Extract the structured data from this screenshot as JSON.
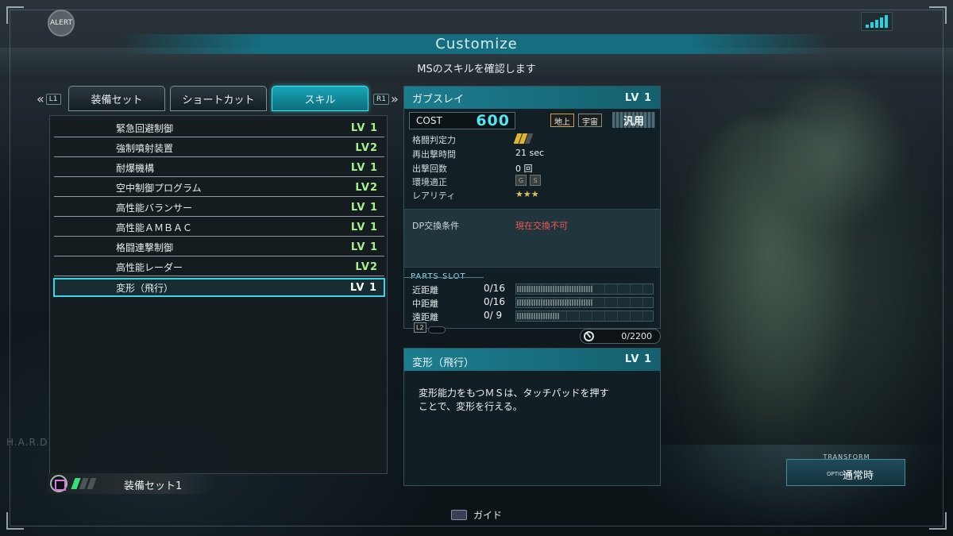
{
  "header": {
    "alert_label": "ALERT",
    "title": "Customize",
    "subtitle": "MSのスキルを確認します"
  },
  "side_text": "H.A.R.D",
  "tabs": {
    "left_key": "L1",
    "right_key": "R1",
    "items": [
      {
        "label": "装備セット",
        "active": false
      },
      {
        "label": "ショートカット",
        "active": false
      },
      {
        "label": "スキル",
        "active": true
      }
    ]
  },
  "skills": [
    {
      "name": "緊急回避制御",
      "level": "LV 1"
    },
    {
      "name": "強制噴射装置",
      "level": "LV2"
    },
    {
      "name": "耐爆機構",
      "level": "LV 1"
    },
    {
      "name": "空中制御プログラム",
      "level": "LV2"
    },
    {
      "name": "高性能バランサー",
      "level": "LV 1"
    },
    {
      "name": "高性能ＡＭＢＡＣ",
      "level": "LV 1"
    },
    {
      "name": "格闘連撃制御",
      "level": "LV 1"
    },
    {
      "name": "高性能レーダー",
      "level": "LV2"
    },
    {
      "name": "変形（飛行）",
      "level": "LV 1",
      "selected": true
    }
  ],
  "equip_set": {
    "label": "装備セット1",
    "gauge_on": 1,
    "gauge_total": 3
  },
  "ms": {
    "name": "ガブスレイ",
    "level": "LV 1",
    "cost_label": "COST",
    "cost": "600",
    "terrain": [
      "地上",
      "宇宙"
    ],
    "type": "汎用",
    "stats": [
      {
        "label": "格闘判定力",
        "value": ""
      },
      {
        "label": "再出撃時間",
        "value": "21 sec"
      },
      {
        "label": "出撃回数",
        "value": "0 回"
      },
      {
        "label": "環境適正",
        "value": ""
      },
      {
        "label": "レアリティ",
        "value": ""
      }
    ],
    "melee_level": 2,
    "env_icons": [
      "G",
      "S"
    ],
    "rarity": "★★★",
    "dp_label": "DP交換条件",
    "dp_value": "現在交換不可",
    "parts_slot_label": "PARTS SLOT",
    "slots": [
      {
        "name": "近距離",
        "value": "0/16",
        "fill": 0.56
      },
      {
        "name": "中距離",
        "value": "0/16",
        "fill": 0.56
      },
      {
        "name": "遠距離",
        "value": "0/ 9",
        "fill": 0.31
      }
    ],
    "l2_key": "L2",
    "capacity": "0/2200"
  },
  "skill_detail": {
    "name": "変形（飛行）",
    "level": "LV 1",
    "description_line1": "変形能力をもつＭＳは、タッチパッドを押す",
    "description_line2": "ことで、変形を行える。"
  },
  "transform": {
    "label": "TRANSFORM",
    "options_key": "OPTIONS",
    "value": "通常時"
  },
  "footer": {
    "guide_label": "ガイド"
  },
  "colors": {
    "accent": "#34d8ea",
    "level_green": "#a7f28c",
    "cost": "#4ee8f5",
    "warning": "#ef5a54"
  }
}
